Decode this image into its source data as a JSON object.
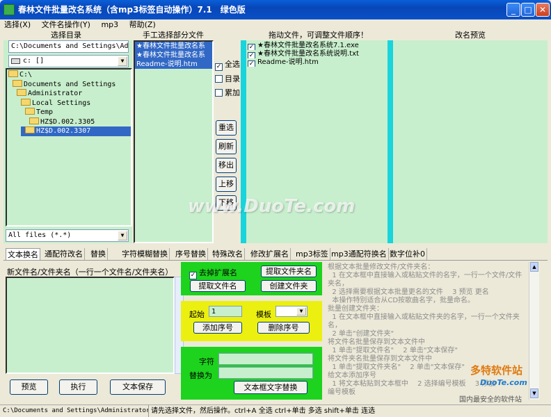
{
  "window": {
    "title": "春林文件批量改名系统（含mp3标签自动操作）7.1　绿色版",
    "minimize": "_",
    "maximize": "□",
    "close": "✕"
  },
  "menu": {
    "items": [
      "选择(X)",
      "文件名操作(Y)",
      "mp3",
      "帮助(Z)"
    ]
  },
  "headers": {
    "select_dir": "选择目录",
    "manual_select": "手工选择部分文件",
    "drag_files": "拖动文件，可调整文件顺序！",
    "rename_preview": "改名预览"
  },
  "dir_path": "C:\\Documents and Settings\\Ad",
  "drive": "c: []",
  "tree": [
    "C:\\",
    "Documents and Settings",
    "Administrator",
    "Local Settings",
    "Temp",
    "HZ$D.002.3305",
    "HZ$D.002.3307"
  ],
  "filter": "All files (*.*)",
  "manual_files": [
    "★春林文件批量改名系",
    "★春林文件批量改名系",
    "Readme-说明.htm"
  ],
  "options": {
    "select_all": "全选",
    "directory": "目录",
    "append": "累加"
  },
  "actions": {
    "reselect": "重选",
    "refresh": "刷新",
    "remove": "移出",
    "move_up": "上移",
    "move_down": "下移"
  },
  "drag_files": [
    "★春林文件批量改名系统7.1.exe",
    "★春林文件批量改名系统说明.txt",
    "Readme-说明.htm"
  ],
  "tabs": [
    "文本换名",
    "通配符改名",
    "替换",
    "字符模糊替换",
    "序号替换",
    "特殊改名",
    "修改扩展名",
    "mp3标签",
    "mp3通配符换名",
    "数字位补0"
  ],
  "text_rename": {
    "caption": "新文件名/文件夹名（一行一个文件名/文件夹名）",
    "preview": "预览",
    "execute": "执行",
    "save_text": "文本保存"
  },
  "green_panel": {
    "remove_ext": "去掉扩展名",
    "extract_folder": "提取文件夹名",
    "extract_file": "提取文件名",
    "create_folder": "创建文件夹"
  },
  "yellow_panel": {
    "start_label": "起始",
    "start_value": "1",
    "template_label": "模板",
    "template_value": "",
    "add_seq": "添加序号",
    "del_seq": "删除序号"
  },
  "replace_panel": {
    "char_label": "字符",
    "replace_with": "替换为",
    "replace_btn": "文本框文字替换"
  },
  "help_text": "根据文本批量修改文件/文件夹名：\n  1 在文本框中直接输入或粘贴文件的名字，一行一个文件/文件夹名，\n  2 选择需要根据文本批量更名的文件　 3 预览 更名\n  本操作特别适合从CD按歌曲名字，批量命名。\n批量创建文件夹：\n  1 在文本框中直接输入或粘贴文件夹的名字，一行一个文件夹名，\n  2 单击\"创建文件夹\"\n将文件名批量保存到文本文件中\n  1 单击\"提取文件名\"　 2 单击\"文本保存\"\n将文件夹名批量保存到文本文件中\n  1 单击\"提取文件夹名\"　 2 单击\"文本保存\"\n给文本添加序号\n  1 将文本粘贴到文本框中　 2 选择编号模板　 3 添加\n编号模板",
  "watermark": {
    "center": "www.DuoTe.com",
    "corner_brand": "多特软件站",
    "corner_url": "DuoTe.com",
    "corner_slogan": "国内最安全的软件站"
  },
  "status": {
    "path": "C:\\Documents and Settings\\Administrator\\L",
    "hint": "请先选择文件，然后操作。ctrl+A 全选 ctrl+单击 多选 shift+单击 连选"
  }
}
